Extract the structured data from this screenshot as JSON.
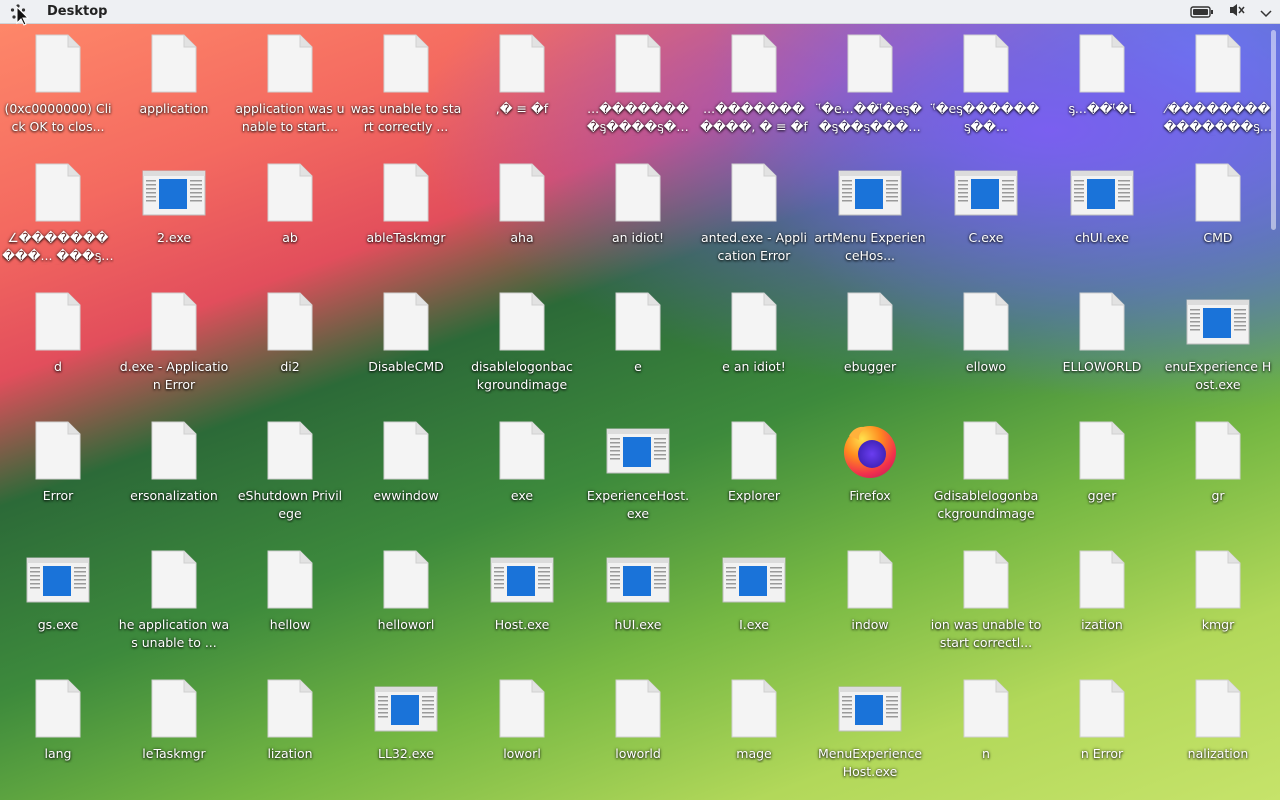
{
  "topbar": {
    "title": "Desktop"
  },
  "icons": [
    {
      "label": "(0xc0000000) Click OK to clos...",
      "type": "file"
    },
    {
      "label": "application",
      "type": "file"
    },
    {
      "label": "application was unable to start...",
      "type": "file"
    },
    {
      "label": "was unable to start correctly ...",
      "type": "file"
    },
    {
      "label": ",� ≡ �f",
      "type": "file"
    },
    {
      "label": "...��������ᶊ����ᶊ������†...",
      "type": "file"
    },
    {
      "label": "...�����������, � ≡ �f",
      "type": "file"
    },
    {
      "label": "⁽̈�e...��⁽̈�eᶊ��ᶊ��ᶊ�����...",
      "type": "file"
    },
    {
      "label": "⁽̈�eᶊ������ᶊ��...",
      "type": "file"
    },
    {
      "label": "ᶊ...��⁽̈�L",
      "type": "file"
    },
    {
      "label": "⁄���������������ᶊ��...",
      "type": "file"
    },
    {
      "label": "∠����������... ���ᶊ�������...",
      "type": "file"
    },
    {
      "label": "2.exe",
      "type": "exe"
    },
    {
      "label": "ab",
      "type": "file"
    },
    {
      "label": "ableTaskmgr",
      "type": "file"
    },
    {
      "label": "aha",
      "type": "file"
    },
    {
      "label": "an idiot!",
      "type": "file"
    },
    {
      "label": "anted.exe - Application Error",
      "type": "file"
    },
    {
      "label": "artMenu ExperienceHos...",
      "type": "exe"
    },
    {
      "label": "C.exe",
      "type": "exe"
    },
    {
      "label": "chUI.exe",
      "type": "exe"
    },
    {
      "label": "CMD",
      "type": "file"
    },
    {
      "label": "d",
      "type": "file"
    },
    {
      "label": "d.exe - Application Error",
      "type": "file"
    },
    {
      "label": "di2",
      "type": "file"
    },
    {
      "label": "DisableCMD",
      "type": "file"
    },
    {
      "label": "disablelogonbac kgroundimage",
      "type": "file"
    },
    {
      "label": "e",
      "type": "file"
    },
    {
      "label": "e an idiot!",
      "type": "file"
    },
    {
      "label": "ebugger",
      "type": "file"
    },
    {
      "label": "ellowo",
      "type": "file"
    },
    {
      "label": "ELLOWORLD",
      "type": "file"
    },
    {
      "label": "enuExperience Host.exe",
      "type": "exe"
    },
    {
      "label": "Error",
      "type": "file"
    },
    {
      "label": "ersonalization",
      "type": "file"
    },
    {
      "label": "eShutdown Privilege",
      "type": "file"
    },
    {
      "label": "ewwindow",
      "type": "file"
    },
    {
      "label": "exe",
      "type": "file"
    },
    {
      "label": "ExperienceHost. exe",
      "type": "exe"
    },
    {
      "label": "Explorer",
      "type": "file"
    },
    {
      "label": "Firefox",
      "type": "firefox"
    },
    {
      "label": "Gdisablelogonba ckgroundimage",
      "type": "file"
    },
    {
      "label": "gger",
      "type": "file"
    },
    {
      "label": "gr",
      "type": "file"
    },
    {
      "label": "gs.exe",
      "type": "exe"
    },
    {
      "label": "he application was unable to ...",
      "type": "file"
    },
    {
      "label": "hellow",
      "type": "file"
    },
    {
      "label": "helloworl",
      "type": "file"
    },
    {
      "label": "Host.exe",
      "type": "exe"
    },
    {
      "label": "hUI.exe",
      "type": "exe"
    },
    {
      "label": "I.exe",
      "type": "exe"
    },
    {
      "label": "indow",
      "type": "file"
    },
    {
      "label": "ion was unable to start correctl...",
      "type": "file"
    },
    {
      "label": "ization",
      "type": "file"
    },
    {
      "label": "kmgr",
      "type": "file"
    },
    {
      "label": "lang",
      "type": "file"
    },
    {
      "label": "leTaskmgr",
      "type": "file"
    },
    {
      "label": "lization",
      "type": "file"
    },
    {
      "label": "LL32.exe",
      "type": "exe"
    },
    {
      "label": "loworl",
      "type": "file"
    },
    {
      "label": "loworld",
      "type": "file"
    },
    {
      "label": "mage",
      "type": "file"
    },
    {
      "label": "MenuExperience Host.exe",
      "type": "exe"
    },
    {
      "label": "n",
      "type": "file"
    },
    {
      "label": "n Error",
      "type": "file"
    },
    {
      "label": "nalization",
      "type": "file"
    }
  ],
  "tray": {
    "battery": "battery-icon",
    "volume": "volume-muted-icon",
    "menu": "chevron-down-icon"
  }
}
